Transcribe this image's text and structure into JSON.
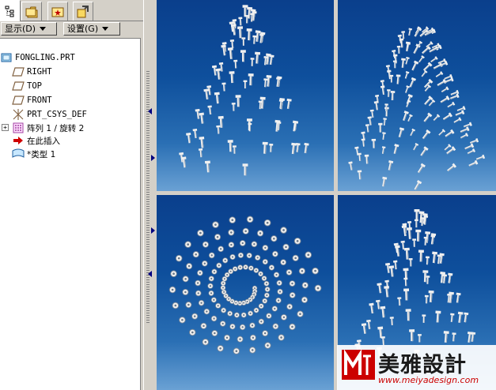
{
  "tabs": [
    {
      "name": "model-tree-tab",
      "icon": "model-tree-icon"
    },
    {
      "name": "folder-browser-tab",
      "icon": "folder-icon"
    },
    {
      "name": "favorites-tab",
      "icon": "favorites-icon"
    },
    {
      "name": "connections-tab",
      "icon": "connections-icon"
    }
  ],
  "toolbar": {
    "display_label": "显示(D)",
    "settings_label": "设置(G)"
  },
  "tree": {
    "items": [
      {
        "label": "FONGLING.PRT",
        "icon": "part-icon"
      },
      {
        "label": "RIGHT",
        "icon": "datum-plane-icon"
      },
      {
        "label": "TOP",
        "icon": "datum-plane-icon"
      },
      {
        "label": "FRONT",
        "icon": "datum-plane-icon"
      },
      {
        "label": "PRT_CSYS_DEF",
        "icon": "csys-icon"
      },
      {
        "label": "阵列 1 / 旋转 2",
        "icon": "pattern-icon"
      },
      {
        "label": "在此插入",
        "icon": "insert-here-icon"
      },
      {
        "label": "*类型 1",
        "icon": "feature-icon"
      }
    ]
  },
  "watermark": {
    "title": "美雅設計",
    "url": "www.meiyadesign.com"
  },
  "colors": {
    "viewport_top": "#0a3f8c",
    "viewport_bottom": "#6aa1d4",
    "screw": "#f0f0f0",
    "panel": "#d4d0c8",
    "accent_red": "#cc0000"
  }
}
